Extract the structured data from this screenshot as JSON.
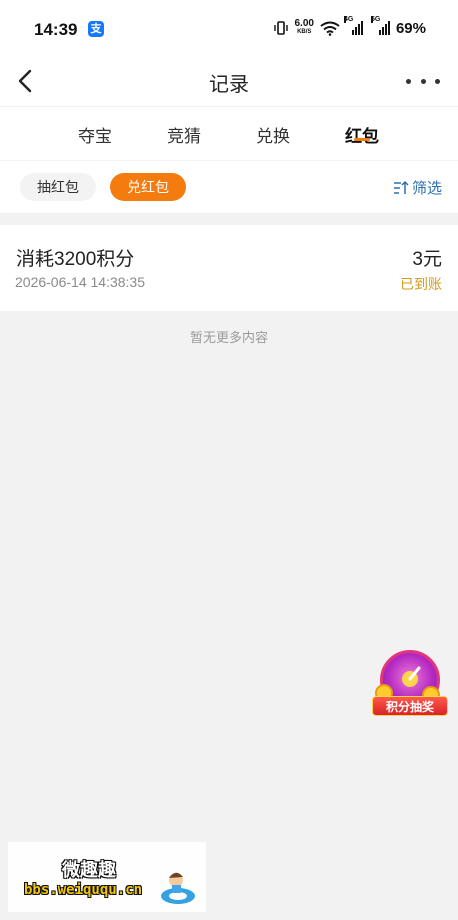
{
  "status_bar": {
    "time": "14:39",
    "app_icon": "支",
    "net_speed": "6.00",
    "net_speed_unit": "KB/S",
    "sim1_tag": "4G",
    "sim2_tag": "5G",
    "battery": "69%"
  },
  "nav": {
    "title": "记录",
    "back_icon": "chevron-left-icon",
    "more_icon": "more-horizontal-icon"
  },
  "tabs": [
    {
      "label": "夺宝",
      "active": false
    },
    {
      "label": "竞猜",
      "active": false
    },
    {
      "label": "兑换",
      "active": false
    },
    {
      "label": "红包",
      "active": true
    }
  ],
  "filters": {
    "pills": [
      {
        "label": "抽红包",
        "active": false
      },
      {
        "label": "兑红包",
        "active": true
      }
    ],
    "filter_label": "筛选"
  },
  "records": [
    {
      "title": "消耗3200积分",
      "time": "2026-06-14 14:38:35",
      "amount": "3元",
      "status": "已到账"
    }
  ],
  "footer_text": "暂无更多内容",
  "lottery_widget": {
    "label": "积分抽奖"
  },
  "watermark": {
    "title": "微趣趣",
    "url": "bbs.weiququ.cn"
  },
  "colors": {
    "accent": "#f47c0e",
    "link": "#2d6fae",
    "credited": "#d39a1c"
  }
}
